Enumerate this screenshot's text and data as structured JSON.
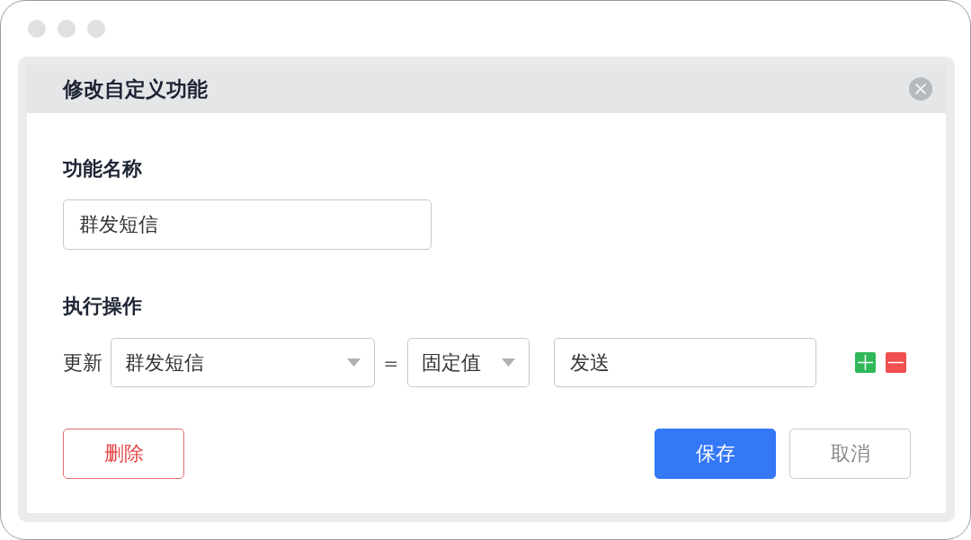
{
  "dialog": {
    "title": "修改自定义功能"
  },
  "name_field": {
    "label": "功能名称",
    "value": "群发短信"
  },
  "action": {
    "label": "执行操作",
    "rows": [
      {
        "verb": "更新",
        "field": "群发短信",
        "operator": "=",
        "value_type": "固定值",
        "value": "发送"
      }
    ]
  },
  "buttons": [
    {
      "label": "删除",
      "kind": "danger"
    },
    {
      "label": "保存",
      "kind": "primary"
    },
    {
      "label": "取消",
      "kind": "default"
    }
  ]
}
